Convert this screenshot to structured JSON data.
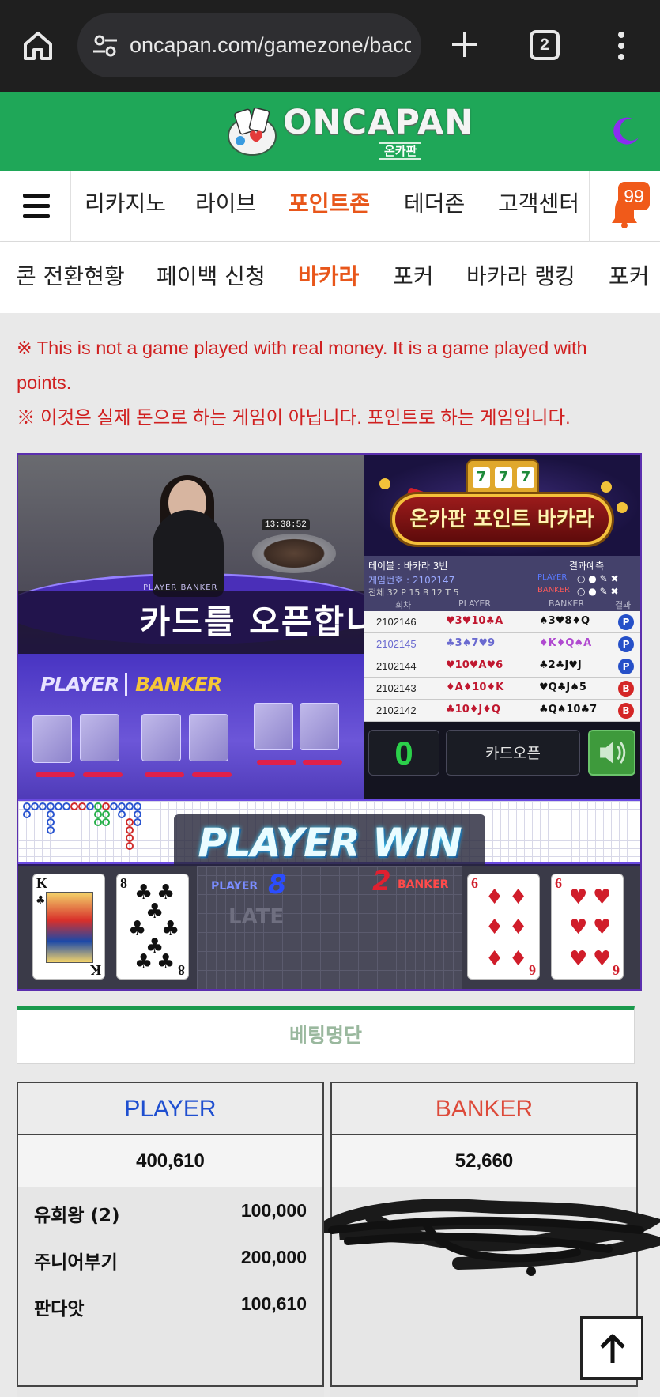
{
  "browser": {
    "url": "oncapan.com/gamezone/bacc",
    "tab_count": "2"
  },
  "site": {
    "logo_text": "ONCAPAN",
    "logo_sub": "온카판",
    "notification_count": "99"
  },
  "main_nav": [
    {
      "label": "리카지노",
      "active": false
    },
    {
      "label": "라이브",
      "active": false
    },
    {
      "label": "포인트존",
      "active": true
    },
    {
      "label": "테더존",
      "active": false
    },
    {
      "label": "고객센터",
      "active": false
    }
  ],
  "sub_nav": [
    {
      "label": "콘 전환현황",
      "active": false
    },
    {
      "label": "페이백 신청",
      "active": false
    },
    {
      "label": "바카라",
      "active": true
    },
    {
      "label": "포커",
      "active": false
    },
    {
      "label": "바카라 랭킹",
      "active": false
    },
    {
      "label": "포커",
      "active": false
    }
  ],
  "notices": {
    "english": "※ This is not a game played with real money. It is a game played with points.",
    "korean": "※ 이것은 실제 돈으로 하는 게임이 아닙니다. 포인트로 하는 게임입니다."
  },
  "game": {
    "video_clock": "13:38:52",
    "video_table_text": "PLAYER  BANKER",
    "banner_message": "카드를 오픈합니다.",
    "player_label": "PLAYER",
    "banker_label": "BANKER",
    "promo_title": "온카판 포인트 바카라",
    "table_name": "테이블 : 바카라 3번",
    "game_number": "게임번호 : 2102147",
    "prediction_label": "결과예측",
    "pred_player": "PLAYER",
    "pred_banker": "BANKER",
    "stats_text": "전체 32   P 15   B 12   T 5",
    "history_headers": [
      "회차",
      "PLAYER",
      "BANKER",
      "결과"
    ],
    "history": [
      {
        "round": "2102146",
        "player": "♥3♥10♣A",
        "banker": "♠3♥8♦Q",
        "result": "P"
      },
      {
        "round": "2102145",
        "player": "♣3♠7♥9",
        "banker": "♦K♦Q♠A",
        "result": "P"
      },
      {
        "round": "2102144",
        "player": "♥10♥A♥6",
        "banker": "♣2♣J♥J",
        "result": "P"
      },
      {
        "round": "2102143",
        "player": "♦A♦10♦K",
        "banker": "♥Q♣J♠5",
        "result": "B"
      },
      {
        "round": "2102142",
        "player": "♣10♦J♦Q",
        "banker": "♣Q♠10♣7",
        "result": "B"
      }
    ],
    "countdown": "0",
    "open_button": "카드오픈",
    "win_text": "PLAYER WIN",
    "player_score_label": "PLAYER",
    "player_score": "8",
    "banker_score": "2",
    "banker_score_label": "BANKER",
    "watermark": "LATE",
    "player_cards": [
      {
        "rank": "K",
        "suit": "♣"
      },
      {
        "rank": "8",
        "suit": "♣"
      }
    ],
    "banker_cards": [
      {
        "rank": "6",
        "suit": "♦"
      },
      {
        "rank": "6",
        "suit": "♥"
      }
    ]
  },
  "betting": {
    "title": "베팅명단",
    "player": {
      "label": "PLAYER",
      "total": "400,610",
      "bets": [
        {
          "name": "유희왕 (2)",
          "amount": "100,000"
        },
        {
          "name": "주니어부기",
          "amount": "200,000"
        },
        {
          "name": "판다앗",
          "amount": "100,610"
        }
      ]
    },
    "banker": {
      "label": "BANKER",
      "total": "52,660"
    }
  },
  "colors": {
    "header_green": "#1fa758",
    "accent_orange": "#e8561a",
    "notice_red": "#d02020",
    "player_blue": "#1f4fd0",
    "banker_red": "#dd4a3a"
  }
}
